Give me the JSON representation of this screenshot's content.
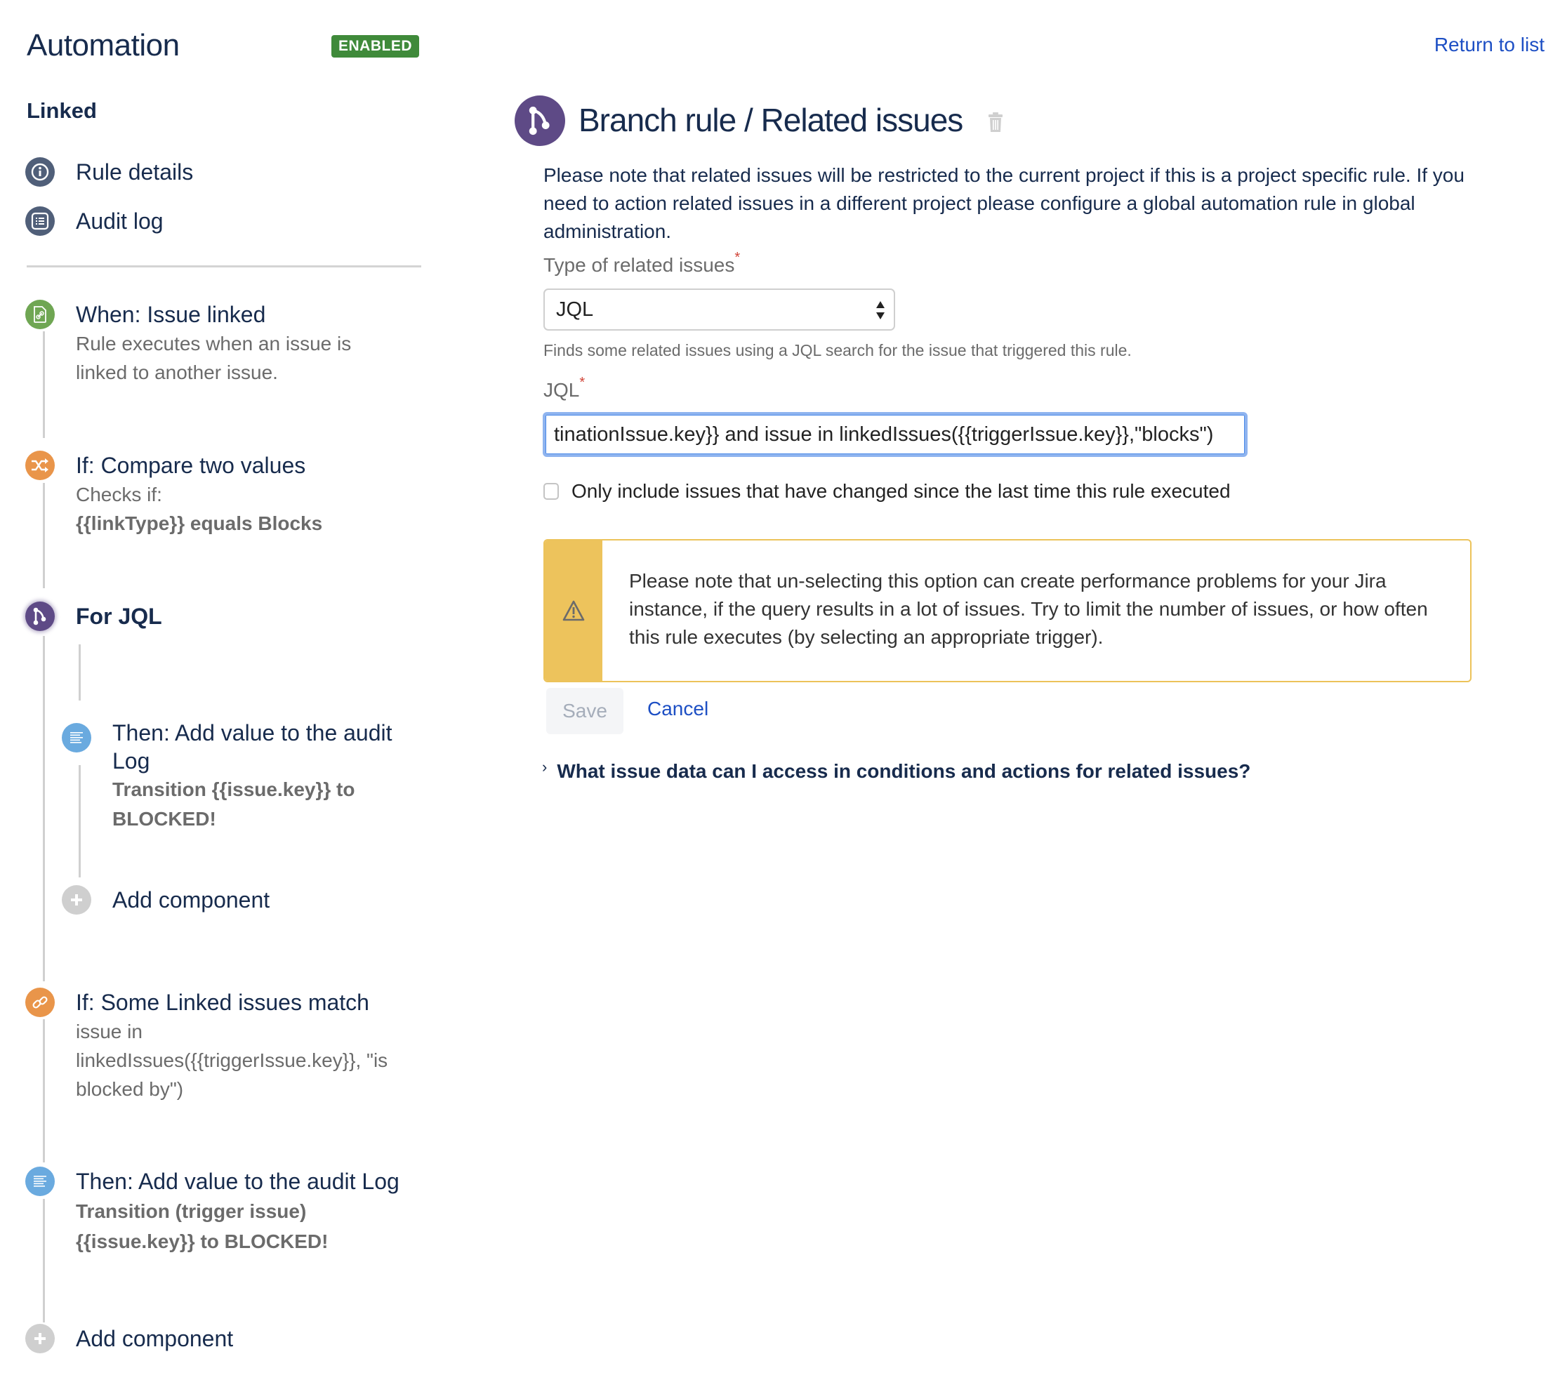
{
  "header": {
    "app_title": "Automation",
    "status_badge": "ENABLED",
    "return_link": "Return to list"
  },
  "sidebar": {
    "rule_name": "Linked",
    "nav": [
      {
        "label": "Rule details",
        "icon": "info-icon"
      },
      {
        "label": "Audit log",
        "icon": "list-icon"
      }
    ],
    "steps": [
      {
        "icon": "issue-linked-icon",
        "color": "#6fa653",
        "title": "When: Issue linked",
        "desc_lines": [
          "Rule executes when an issue is",
          "linked to another issue."
        ]
      },
      {
        "icon": "shuffle-icon",
        "color": "#e9954a",
        "title": "If: Compare two values",
        "desc_lines": [
          "Checks if:"
        ],
        "bold_lines": [
          "{{linkType}} equals Blocks"
        ]
      },
      {
        "icon": "branch-icon",
        "color": "#5e4a86",
        "title": "For JQL",
        "selected": true
      },
      {
        "icon": "audit-log-icon",
        "color": "#6aaadf",
        "title": "Then: Add value to the audit Log",
        "bold_lines": [
          "Transition {{issue.key}} to",
          "BLOCKED!"
        ],
        "nested": true
      },
      {
        "icon": "plus-icon",
        "color": "#cfcfcf",
        "title": "Add component",
        "nested": true
      },
      {
        "icon": "link-icon",
        "color": "#e9954a",
        "title": "If: Some Linked issues match",
        "desc_lines": [
          "issue in",
          "linkedIssues({{triggerIssue.key}}, \"is",
          "blocked by\")"
        ]
      },
      {
        "icon": "audit-log-icon",
        "color": "#6aaadf",
        "title": "Then: Add value to the audit Log",
        "bold_lines": [
          "Transition (trigger issue)",
          "{{issue.key}} to BLOCKED!"
        ]
      },
      {
        "icon": "plus-icon",
        "color": "#cfcfcf",
        "title": "Add component"
      }
    ]
  },
  "main": {
    "title": "Branch rule / Related issues",
    "notice": "Please note that related issues will be restricted to the current project if this is a project specific rule. If you need to action related issues in a different project please configure a global automation rule in global administration.",
    "type_label": "Type of related issues",
    "type_value": "JQL",
    "type_help": "Finds some related issues using a JQL search for the issue that triggered this rule.",
    "jql_label": "JQL",
    "jql_value": "tinationIssue.key}} and issue in linkedIssues({{triggerIssue.key}},\"blocks\")",
    "checkbox_label": "Only include issues that have changed since the last time this rule executed",
    "checkbox_checked": false,
    "warning_text": "Please note that un-selecting this option can create performance problems for your Jira instance, if the query results in a lot of issues. Try to limit the number of issues, or how often this rule executes (by selecting an appropriate trigger).",
    "save_label": "Save",
    "cancel_label": "Cancel",
    "expander_label": "What issue data can I access in conditions and actions for related issues?"
  },
  "colors": {
    "badge_green": "#3f8a3a",
    "link_blue": "#1d4fc4",
    "warning_yellow": "#edc35c",
    "branch_purple": "#5e4a86",
    "nav_icon": "#505f79",
    "required_red": "#d04437"
  }
}
